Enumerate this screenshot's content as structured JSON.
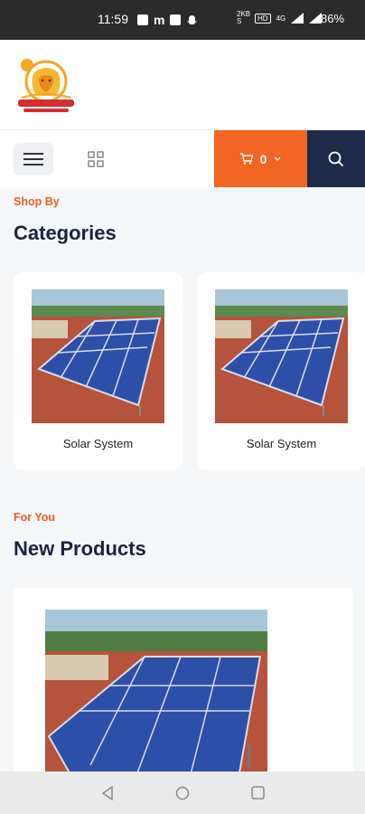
{
  "status_bar": {
    "time": "11:59",
    "network_label": "4G",
    "battery": "86%"
  },
  "header": {
    "logo_icon": "lion-sun-logo"
  },
  "toolbar": {
    "menu_icon": "hamburger-menu-icon",
    "grid_icon": "grid-view-icon",
    "cart_count": "0",
    "cart_icon": "cart-icon",
    "search_icon": "search-icon",
    "accent_color": "#f26522",
    "dark_color": "#1d2a4a"
  },
  "categories_section": {
    "eyebrow": "Shop By",
    "title": "Categories",
    "items": [
      {
        "label": "Solar System"
      },
      {
        "label": "Solar System"
      }
    ]
  },
  "products_section": {
    "eyebrow": "For You",
    "title": "New Products"
  },
  "nav_bar": {
    "back_icon": "back-triangle-icon",
    "home_icon": "home-circle-icon",
    "recents_icon": "recents-square-icon"
  }
}
